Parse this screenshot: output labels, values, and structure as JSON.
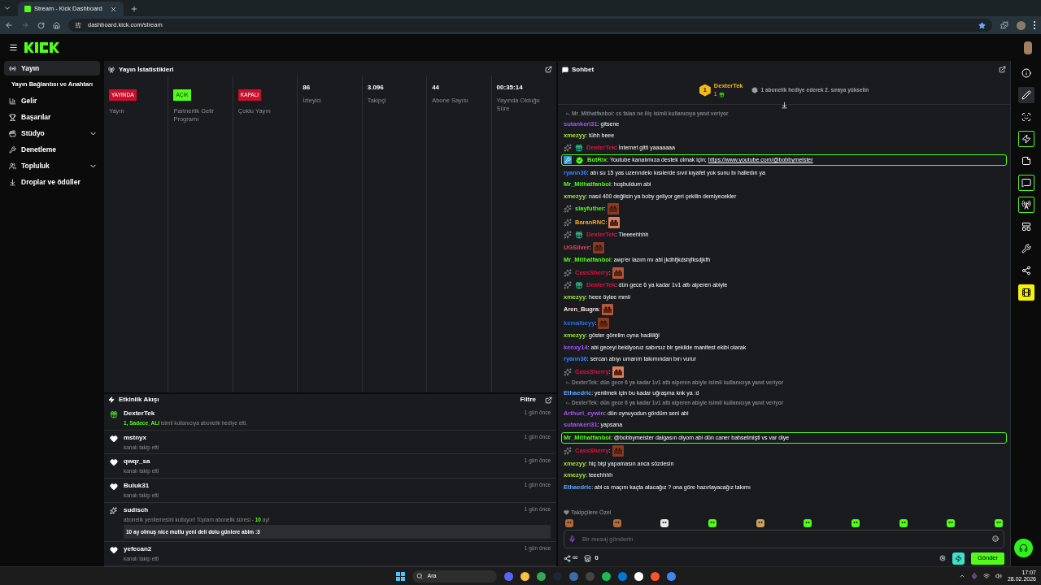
{
  "browser": {
    "tab_title": "Stream - Kick Dashboard",
    "url": "dashboard.kick.com/stream"
  },
  "sidebar": {
    "items": [
      {
        "label": "Yayın",
        "kind": "main",
        "selected": true,
        "expandable": false
      },
      {
        "label": "Yayın Bağlantısı ve Anahtarı",
        "kind": "sub",
        "selected": false,
        "expandable": false
      },
      {
        "label": "Gelir",
        "kind": "main",
        "selected": false,
        "expandable": false
      },
      {
        "label": "Başarılar",
        "kind": "main",
        "selected": false,
        "expandable": false
      },
      {
        "label": "Stüdyo",
        "kind": "main",
        "selected": false,
        "expandable": true
      },
      {
        "label": "Denetleme",
        "kind": "main",
        "selected": false,
        "expandable": false
      },
      {
        "label": "Topluluk",
        "kind": "main",
        "selected": false,
        "expandable": true
      },
      {
        "label": "Droplar ve ödüller",
        "kind": "main",
        "selected": false,
        "expandable": false
      }
    ]
  },
  "stats": {
    "title": "Yayın İstatistikleri",
    "items": [
      {
        "kind": "status",
        "status": "YAYINDA",
        "color": "#c8102e",
        "label": "Yayın"
      },
      {
        "kind": "status",
        "status": "AÇIK",
        "color": "#53fc18",
        "label": "Partnerlik Gelir Programı"
      },
      {
        "kind": "status",
        "status": "KAPALI",
        "color": "#c8102e",
        "label": "Çoklu Yayın"
      },
      {
        "kind": "number",
        "value": "86",
        "label": "İzleyici"
      },
      {
        "kind": "number",
        "value": "3.096",
        "label": "Takipçi"
      },
      {
        "kind": "number",
        "value": "44",
        "label": "Abone Sayısı"
      },
      {
        "kind": "number",
        "value": "00:35:14",
        "label": "Yayında Olduğu Süre"
      }
    ]
  },
  "activity": {
    "title": "Etkinlik Akışı",
    "filter": "Filtre",
    "items": [
      {
        "kind": "gift",
        "user": "DexterTek",
        "time": "1 gün önce",
        "parts": [
          {
            "text": "1, Sadece_ALI",
            "accent": true
          },
          {
            "text": " isimli kullanıcıya abonelik hediye etti.",
            "accent": false
          }
        ]
      },
      {
        "kind": "follow",
        "user": "mstnyx",
        "time": "1 gün önce",
        "parts": [
          {
            "text": "kanalı takip etti",
            "accent": false
          }
        ]
      },
      {
        "kind": "follow",
        "user": "qwqr_sa",
        "time": "1 gün önce",
        "parts": [
          {
            "text": "kanalı takip etti",
            "accent": false
          }
        ]
      },
      {
        "kind": "follow",
        "user": "Buluk31",
        "time": "1 gün önce",
        "parts": [
          {
            "text": "kanalı takip etti",
            "accent": false
          }
        ]
      },
      {
        "kind": "resub",
        "user": "sudisch",
        "time": "1 gün önce",
        "parts": [
          {
            "text": "abonelik yenilemesini kutluyor! Toplam abonelik süresi - ",
            "accent": false
          },
          {
            "text": "10",
            "accent": true
          },
          {
            "text": " ay!",
            "accent": false
          }
        ],
        "message": "10 ay olmuş nice mutlu yeni deli dolu günlere abim :3"
      },
      {
        "kind": "follow",
        "user": "yefecan2",
        "time": "1 gün önce",
        "parts": [
          {
            "text": "kanalı takip etti",
            "accent": false
          }
        ]
      }
    ]
  },
  "chat": {
    "title": "Sohbet",
    "leader": {
      "rank": "1",
      "name": "DexterTek",
      "count": "1",
      "hint": "1 abonelik hediye ederek 2. sıraya yükselin"
    },
    "messages": [
      {
        "user": "sutankeri31",
        "color": "#a855f7",
        "text": ": gitsene",
        "emote": false,
        "highlighted": false,
        "reply_to": "Mr_Mithatfanboi: cs falan ne iliş isimli kullanıcıya yanıt veriyor"
      },
      {
        "user": "xmezyy",
        "color": "#a3e635",
        "text": ": tühh beee",
        "emote": false,
        "highlighted": false
      },
      {
        "user": "DexterTek",
        "color": "#e0133f",
        "badges": [
          {
            "kind": "kick"
          },
          {
            "kind": "gift"
          }
        ],
        "text": ": İnternet gitti yaaaaaaa",
        "emote": false,
        "highlighted": false
      },
      {
        "user": "BotRix",
        "color": "#53fc18",
        "badges": [
          {
            "kind": "bot"
          },
          {
            "kind": "verified"
          }
        ],
        "text": ": Youtube kanalımıza destek olmak için; ",
        "link": "https://www.youtube.com/@bobbymeister",
        "emote": false,
        "highlighted": true
      },
      {
        "user": "ryann36",
        "color": "#3b82f6",
        "text": ": abı su 15 yas uzerındekı kısılerde sıvıl kıyafet yok sunu bı halledın ya",
        "emote": false,
        "highlighted": false
      },
      {
        "user": "Mr_Mithatfanboi",
        "color": "#53fc18",
        "text": ": hoşbuldum abi",
        "emote": false,
        "highlighted": false
      },
      {
        "user": "xmezyy",
        "color": "#a3e635",
        "text": ": nasıl 400 değilsin ya boby geliyor geri çekilin demiyecekler",
        "emote": false,
        "highlighted": false
      },
      {
        "user": "slayfuther",
        "color": "#53fc18",
        "badges": [
          {
            "kind": "kick"
          }
        ],
        "text": ":",
        "emote": true,
        "highlighted": false
      },
      {
        "user": "BaranRNC",
        "color": "#f5a524",
        "badges": [
          {
            "kind": "kick"
          }
        ],
        "text": ":",
        "emote": true,
        "highlighted": false
      },
      {
        "user": "DexterTek",
        "color": "#e0133f",
        "badges": [
          {
            "kind": "kick"
          },
          {
            "kind": "gift"
          }
        ],
        "text": ": Tleeeehhhh",
        "emote": false,
        "highlighted": false
      },
      {
        "user": "UGSilver",
        "color": "#f43f5e",
        "text": ":",
        "emote": true,
        "highlighted": false
      },
      {
        "user": "Mr_Mithatfanboi",
        "color": "#53fc18",
        "text": ": awp'er lazım mı abi jkdhfjkdshjfksdjkfh",
        "emote": false,
        "highlighted": false
      },
      {
        "user": "CassSherry",
        "color": "#e0133f",
        "badges": [
          {
            "kind": "kick"
          }
        ],
        "text": ":",
        "emote": true,
        "highlighted": false
      },
      {
        "user": "DexterTek",
        "color": "#e0133f",
        "badges": [
          {
            "kind": "kick"
          },
          {
            "kind": "gift"
          }
        ],
        "text": ": dün gece 6 ya kadar 1v1 attı alperen abiyle",
        "emote": false,
        "highlighted": false
      },
      {
        "user": "xmezyy",
        "color": "#a3e635",
        "text": ": heee öylee mmii",
        "emote": false,
        "highlighted": false
      },
      {
        "user": "Aren_Bugra",
        "color": "#fde2e2",
        "text": ":",
        "emote": true,
        "highlighted": false
      },
      {
        "user": "kemalbeyy",
        "color": "#2f6fe0",
        "text": ":",
        "emote": true,
        "highlighted": false
      },
      {
        "user": "xmezyy",
        "color": "#a3e635",
        "text": ": göster görelim oyna hadiiiiği",
        "emote": false,
        "highlighted": false
      },
      {
        "user": "kenxy14",
        "color": "#a855f7",
        "text": ": abi geceyi bekliyoruz sabırsız bir şekilde manifest ekibi olarak",
        "emote": false,
        "highlighted": false
      },
      {
        "user": "ryann36",
        "color": "#3b82f6",
        "text": ": sercan abıyı umarım takımından bırı vurur",
        "emote": false,
        "highlighted": false
      },
      {
        "user": "CassSherry",
        "color": "#e0133f",
        "badges": [
          {
            "kind": "kick"
          }
        ],
        "text": ":",
        "emote": true,
        "highlighted": false
      },
      {
        "user": "Ethaedric",
        "color": "#60a5fa",
        "text": ": yenilmek için bu kadar uğraşma knk ya :d",
        "emote": false,
        "highlighted": false,
        "reply_to": "DexterTek: dün gece 6 ya kadar 1v1 attı alperen abiyle isimli kullanıcıya yanıt veriyor"
      },
      {
        "user": "Arthuri_eywin",
        "color": "#a855f7",
        "text": ": dün oynuyodun gördüm seni abi",
        "emote": false,
        "highlighted": false,
        "reply_to": "DexterTek: dün gece 6 ya kadar 1v1 attı alperen abiyle isimli kullanıcıya yanıt veriyor"
      },
      {
        "user": "sutankeri31",
        "color": "#a855f7",
        "text": ": yapsana",
        "emote": false,
        "highlighted": false
      },
      {
        "user": "Mr_Mithatfanboi",
        "color": "#53fc18",
        "text": ": @bobbymeister dalgasın diyom abi dün caner bahsetmişti vs var diye",
        "emote": false,
        "highlighted": true
      },
      {
        "user": "CassSherry",
        "color": "#e0133f",
        "badges": [
          {
            "kind": "kick"
          }
        ],
        "text": ":",
        "emote": true,
        "highlighted": false
      },
      {
        "user": "xmezyy",
        "color": "#a3e635",
        "text": ": hiç bişi yapamasın anca sözdesin",
        "emote": false,
        "highlighted": false
      },
      {
        "user": "xmezyy",
        "color": "#a3e635",
        "text": ": teeehhhh",
        "emote": false,
        "highlighted": false
      },
      {
        "user": "Ethaedric",
        "color": "#60a5fa",
        "text": ": abi cs maçını kaçta atacağız ? ona göre hazırlayacağız takımı",
        "emote": false,
        "highlighted": false
      }
    ],
    "followers_only": "Takipçilere Özel",
    "input": {
      "placeholder": "Bir mesaj gönderin"
    },
    "points": "∞",
    "store_count": "0",
    "send": "Gönder"
  },
  "rail": [
    {
      "kind": "info",
      "active": false,
      "pressed": false,
      "highlighted": false
    },
    {
      "kind": "pencil",
      "active": false,
      "pressed": true,
      "highlighted": false
    },
    {
      "kind": "scan",
      "active": false,
      "pressed": false,
      "highlighted": false
    },
    {
      "kind": "zap",
      "active": true,
      "pressed": false,
      "highlighted": false
    },
    {
      "kind": "note",
      "active": false,
      "pressed": false,
      "highlighted": false
    },
    {
      "kind": "chat",
      "active": true,
      "pressed": false,
      "highlighted": false
    },
    {
      "kind": "broadcast",
      "active": true,
      "pressed": false,
      "highlighted": false
    },
    {
      "kind": "layout",
      "active": false,
      "pressed": false,
      "highlighted": false
    },
    {
      "kind": "wrench",
      "active": false,
      "pressed": false,
      "highlighted": false
    },
    {
      "kind": "share",
      "active": false,
      "pressed": false,
      "highlighted": false
    },
    {
      "kind": "film",
      "active": false,
      "pressed": false,
      "highlighted": true
    }
  ],
  "taskbar": {
    "search": "Ara",
    "time": "17:07",
    "date": "28.02.2026"
  }
}
